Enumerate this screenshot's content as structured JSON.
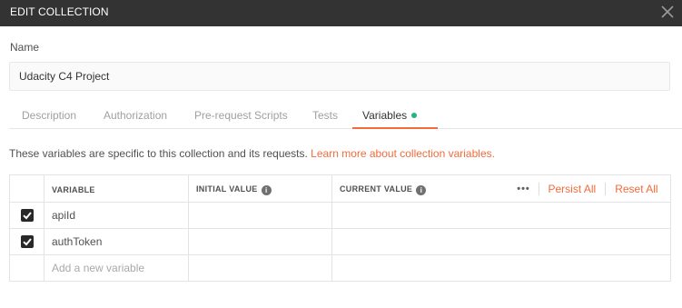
{
  "window": {
    "title": "EDIT COLLECTION"
  },
  "form": {
    "name_label": "Name",
    "name_value": "Udacity C4 Project"
  },
  "tabs": [
    {
      "label": "Description",
      "active": false
    },
    {
      "label": "Authorization",
      "active": false
    },
    {
      "label": "Pre-request Scripts",
      "active": false
    },
    {
      "label": "Tests",
      "active": false
    },
    {
      "label": "Variables",
      "active": true,
      "indicator_color": "#26b47f"
    }
  ],
  "variables_panel": {
    "description": "These variables are specific to this collection and its requests.",
    "learn_more_link": "Learn more about collection variables.",
    "headers": {
      "variable": "VARIABLE",
      "initial_value": "INITIAL VALUE",
      "current_value": "CURRENT VALUE"
    },
    "actions": {
      "more": "•••",
      "persist_all": "Persist All",
      "reset_all": "Reset All"
    },
    "rows": [
      {
        "checked": true,
        "name": "apiId",
        "initial_value": "",
        "current_value": ""
      },
      {
        "checked": true,
        "name": "authToken",
        "initial_value": "",
        "current_value": ""
      }
    ],
    "new_row_placeholder": "Add a new variable"
  },
  "colors": {
    "accent": "#f26b3a",
    "titlebar": "#333333",
    "status_dot": "#26b47f"
  }
}
